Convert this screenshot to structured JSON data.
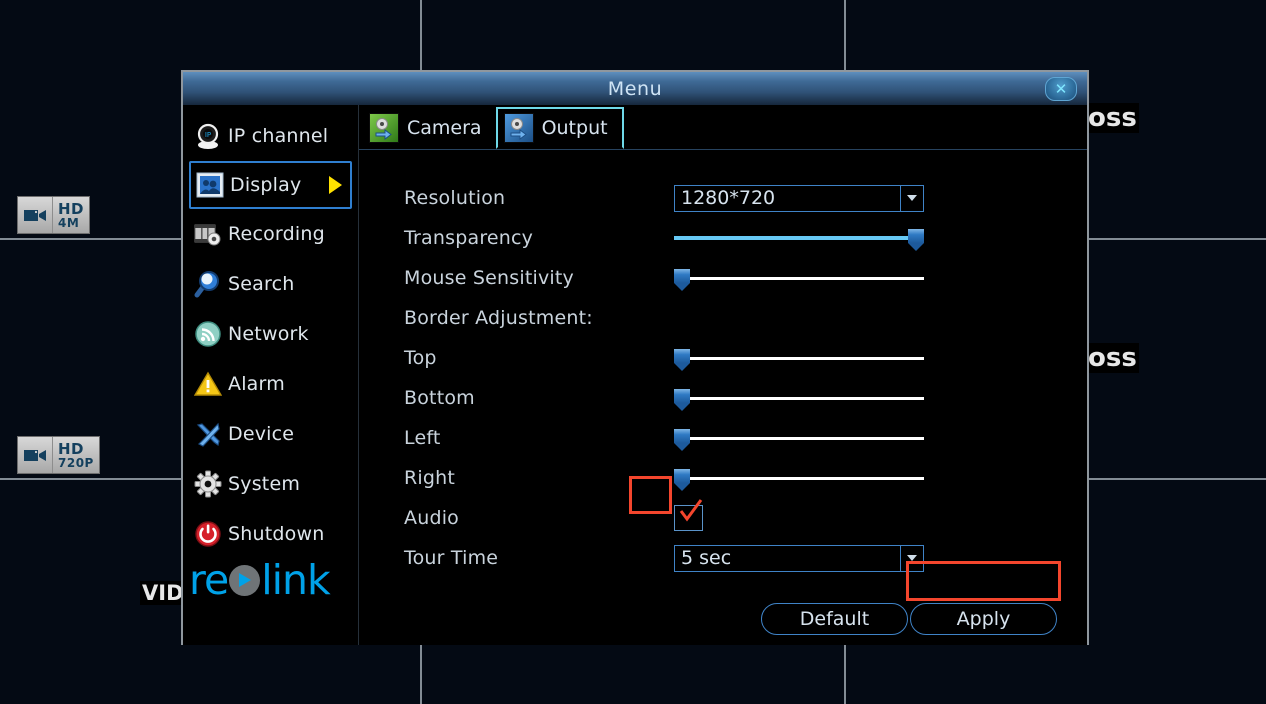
{
  "background": {
    "camera_badges": [
      {
        "name": "hd-4m-badge",
        "line1": "HD",
        "line2": "4M"
      },
      {
        "name": "hd-720p-badge",
        "line1": "HD",
        "line2": "720P"
      }
    ],
    "loss_labels": [
      "oss",
      "oss"
    ],
    "partial_label": "VID"
  },
  "dialog": {
    "title": "Menu",
    "close_icon": "close-icon",
    "close_glyph": "✕"
  },
  "sidebar": {
    "items": [
      {
        "label": "IP channel",
        "icon": "ip-camera-icon",
        "selected": false
      },
      {
        "label": "Display",
        "icon": "display-picture-icon",
        "selected": true
      },
      {
        "label": "Recording",
        "icon": "film-gear-icon",
        "selected": false
      },
      {
        "label": "Search",
        "icon": "magnifier-icon",
        "selected": false
      },
      {
        "label": "Network",
        "icon": "wifi-signal-icon",
        "selected": false
      },
      {
        "label": "Alarm",
        "icon": "warning-triangle-icon",
        "selected": false
      },
      {
        "label": "Device",
        "icon": "tools-icon",
        "selected": false
      },
      {
        "label": "System",
        "icon": "gear-icon",
        "selected": false
      },
      {
        "label": "Shutdown",
        "icon": "power-icon",
        "selected": false
      }
    ],
    "logo": {
      "part1": "re",
      "part2": "link",
      "accent_color": "#00a2e8",
      "circle_color": "#6f7477"
    }
  },
  "tabs": [
    {
      "label": "Camera",
      "icon": "camera-settings-icon",
      "active": false
    },
    {
      "label": "Output",
      "icon": "output-settings-icon",
      "active": true
    }
  ],
  "form": {
    "resolution": {
      "label": "Resolution",
      "value": "1280*720"
    },
    "transparency": {
      "label": "Transparency",
      "percent": 100
    },
    "mouse_sensitivity": {
      "label": "Mouse Sensitivity",
      "percent": 0
    },
    "border_adjustment": {
      "label": "Border Adjustment:"
    },
    "top": {
      "label": "Top",
      "percent": 0
    },
    "bottom": {
      "label": "Bottom",
      "percent": 0
    },
    "left": {
      "label": "Left",
      "percent": 0
    },
    "right": {
      "label": "Right",
      "percent": 0
    },
    "audio": {
      "label": "Audio",
      "checked": true,
      "highlight_color": "#f4462d"
    },
    "tour_time": {
      "label": "Tour Time",
      "value": "5 sec"
    }
  },
  "buttons": {
    "default_label": "Default",
    "apply_label": "Apply",
    "apply_highlight_color": "#f4462d"
  }
}
